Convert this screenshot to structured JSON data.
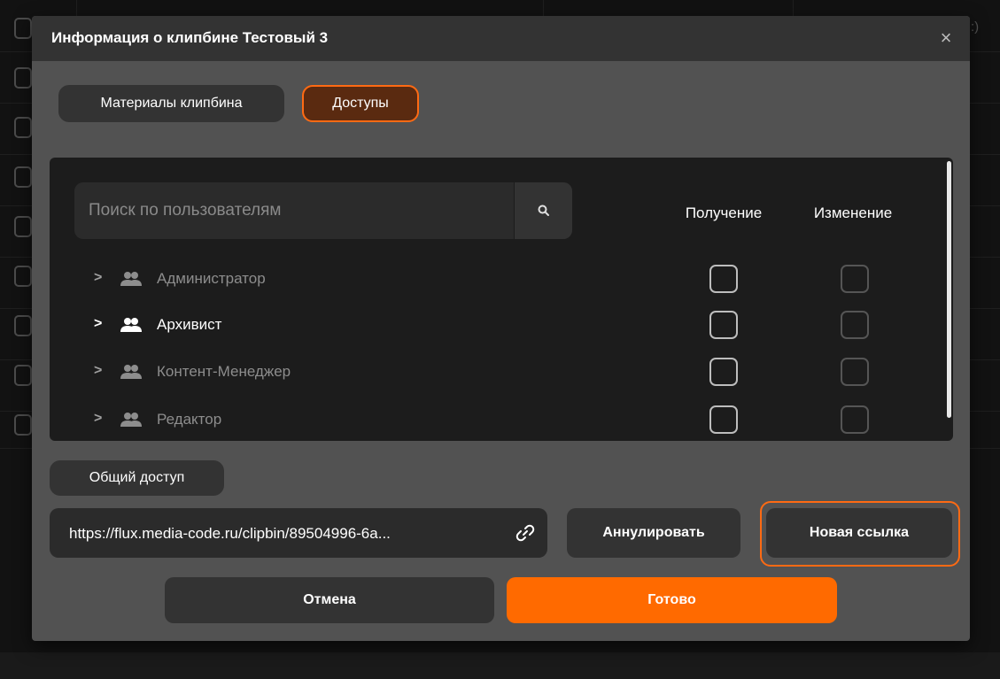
{
  "modal": {
    "title": "Информация о клипбине Тестовый 3",
    "close_glyph": "×",
    "tabs": [
      {
        "label": "Материалы клипбина",
        "active": false
      },
      {
        "label": "Доступы",
        "active": true
      }
    ]
  },
  "access": {
    "search_placeholder": "Поиск по пользователям",
    "columns": {
      "get": "Получение",
      "edit": "Изменение"
    },
    "groups": [
      {
        "label": "Администратор",
        "highlighted": false,
        "get": false,
        "edit": false
      },
      {
        "label": "Архивист",
        "highlighted": true,
        "get": false,
        "edit": false
      },
      {
        "label": "Контент-Менеджер",
        "highlighted": false,
        "get": false,
        "edit": false
      },
      {
        "label": "Редактор",
        "highlighted": false,
        "get": false,
        "edit": false
      }
    ]
  },
  "shared": {
    "label": "Общий доступ",
    "link": "https://flux.media-code.ru/clipbin/89504996-6a...",
    "revoke_label": "Аннулировать",
    "new_link_label": "Новая ссылка"
  },
  "footer": {
    "cancel_label": "Отмена",
    "done_label": "Готово"
  },
  "background": {
    "right_edge_text": ":)"
  },
  "colors": {
    "accent": "#ff6a00",
    "modal_bg": "#525252",
    "panel_bg": "#1c1c1c"
  },
  "icons": {
    "search": "search-icon",
    "users": "users-group-icon",
    "chevron": "chevron-right-icon",
    "link": "link-icon",
    "close": "close-icon"
  }
}
